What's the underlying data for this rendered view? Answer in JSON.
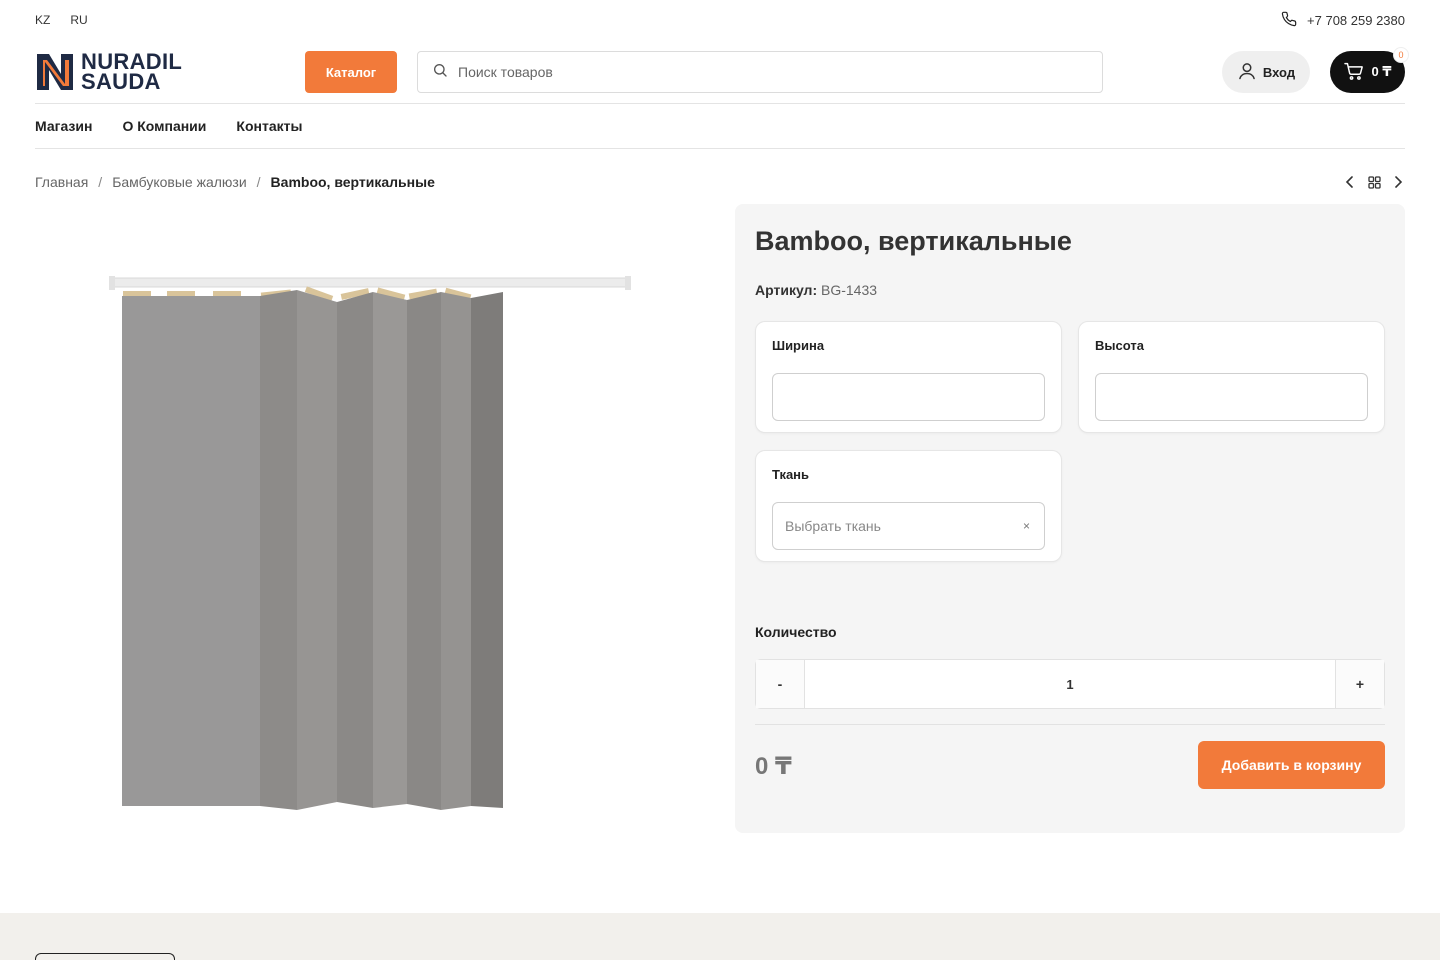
{
  "topbar": {
    "languages": [
      "KZ",
      "RU"
    ],
    "phone": "+7 708 259 2380"
  },
  "header": {
    "logo_line1": "NURADIL",
    "logo_line2": "SAUDA",
    "catalog_label": "Каталог",
    "search_placeholder": "Поиск товаров",
    "login_label": "Вход",
    "cart_total": "0 ₸",
    "cart_count": "0"
  },
  "nav": {
    "items": [
      "Магазин",
      "О Компании",
      "Контакты"
    ]
  },
  "breadcrumb": {
    "items": [
      "Главная",
      "Бамбуковые жалюзи"
    ],
    "current": "Bamboo, вертикальные",
    "separator": "/"
  },
  "product": {
    "title": "Bamboo, вертикальные",
    "sku_label": "Артикул:",
    "sku": "BG-1433",
    "width_label": "Ширина",
    "height_label": "Высота",
    "fabric_label": "Ткань",
    "fabric_placeholder": "Выбрать ткань",
    "clear_symbol": "×",
    "qty_label": "Количество",
    "qty_minus": "-",
    "qty_value": "1",
    "qty_plus": "+",
    "price": "0 ₸",
    "add_to_cart_label": "Добавить в корзину"
  },
  "colors": {
    "accent": "#f27a3a",
    "dark": "#111111",
    "logo_navy": "#1f2a44",
    "blind_gray": "#8f8f8f",
    "panel_bg": "#f5f5f5"
  },
  "icons": [
    "phone-icon",
    "search-icon",
    "user-icon",
    "cart-icon",
    "chevron-left-icon",
    "grid-icon",
    "chevron-right-icon"
  ]
}
